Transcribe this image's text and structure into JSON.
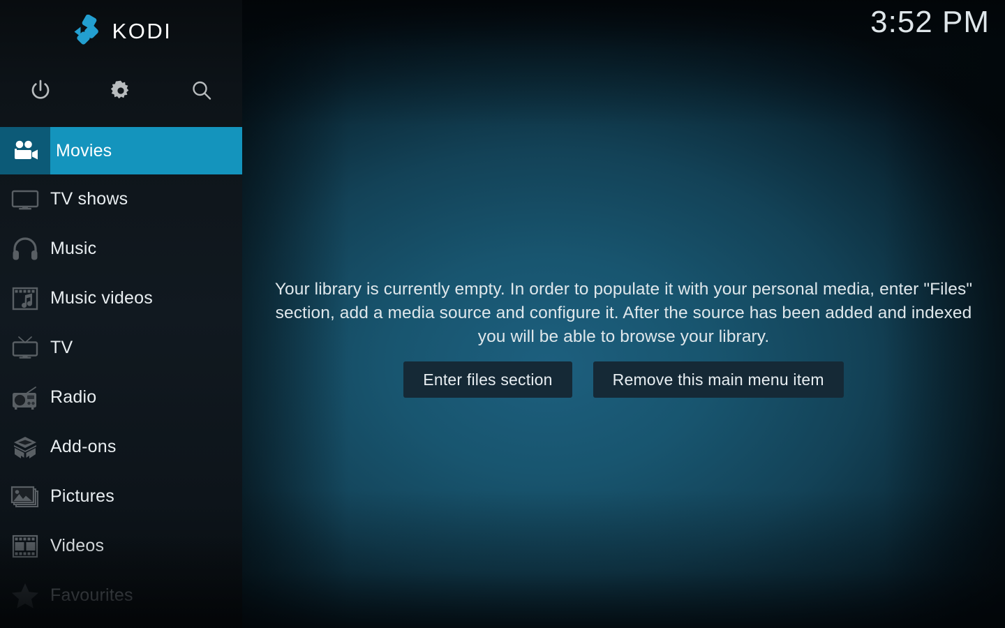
{
  "app": {
    "name": "Kodi",
    "logo_text": "KODI",
    "accent_color": "#1494bd",
    "accent_dark_color": "#0c5a77",
    "logo_blue": "#239fd0"
  },
  "header": {
    "clock": "3:52 PM"
  },
  "sidebar": {
    "top_actions": [
      {
        "name": "power-icon",
        "label": "Power"
      },
      {
        "name": "gear-icon",
        "label": "Settings"
      },
      {
        "name": "search-icon",
        "label": "Search"
      }
    ],
    "items": [
      {
        "label": "Movies",
        "icon": "movie-camera-icon",
        "selected": true,
        "dim": false
      },
      {
        "label": "TV shows",
        "icon": "monitor-icon",
        "selected": false,
        "dim": false
      },
      {
        "label": "Music",
        "icon": "headphones-icon",
        "selected": false,
        "dim": false
      },
      {
        "label": "Music videos",
        "icon": "film-note-icon",
        "selected": false,
        "dim": false
      },
      {
        "label": "TV",
        "icon": "television-icon",
        "selected": false,
        "dim": false
      },
      {
        "label": "Radio",
        "icon": "radio-icon",
        "selected": false,
        "dim": false
      },
      {
        "label": "Add-ons",
        "icon": "open-box-icon",
        "selected": false,
        "dim": false
      },
      {
        "label": "Pictures",
        "icon": "photos-icon",
        "selected": false,
        "dim": false
      },
      {
        "label": "Videos",
        "icon": "film-strip-icon",
        "selected": false,
        "dim": false
      },
      {
        "label": "Favourites",
        "icon": "star-icon",
        "selected": false,
        "dim": true
      }
    ]
  },
  "main": {
    "empty_message": "Your library is currently empty. In order to populate it with your personal media, enter \"Files\" section, add a media source and configure it. After the source has been added and indexed you will be able to browse your library.",
    "buttons": [
      {
        "label": "Enter files section"
      },
      {
        "label": "Remove this main menu item"
      }
    ]
  }
}
